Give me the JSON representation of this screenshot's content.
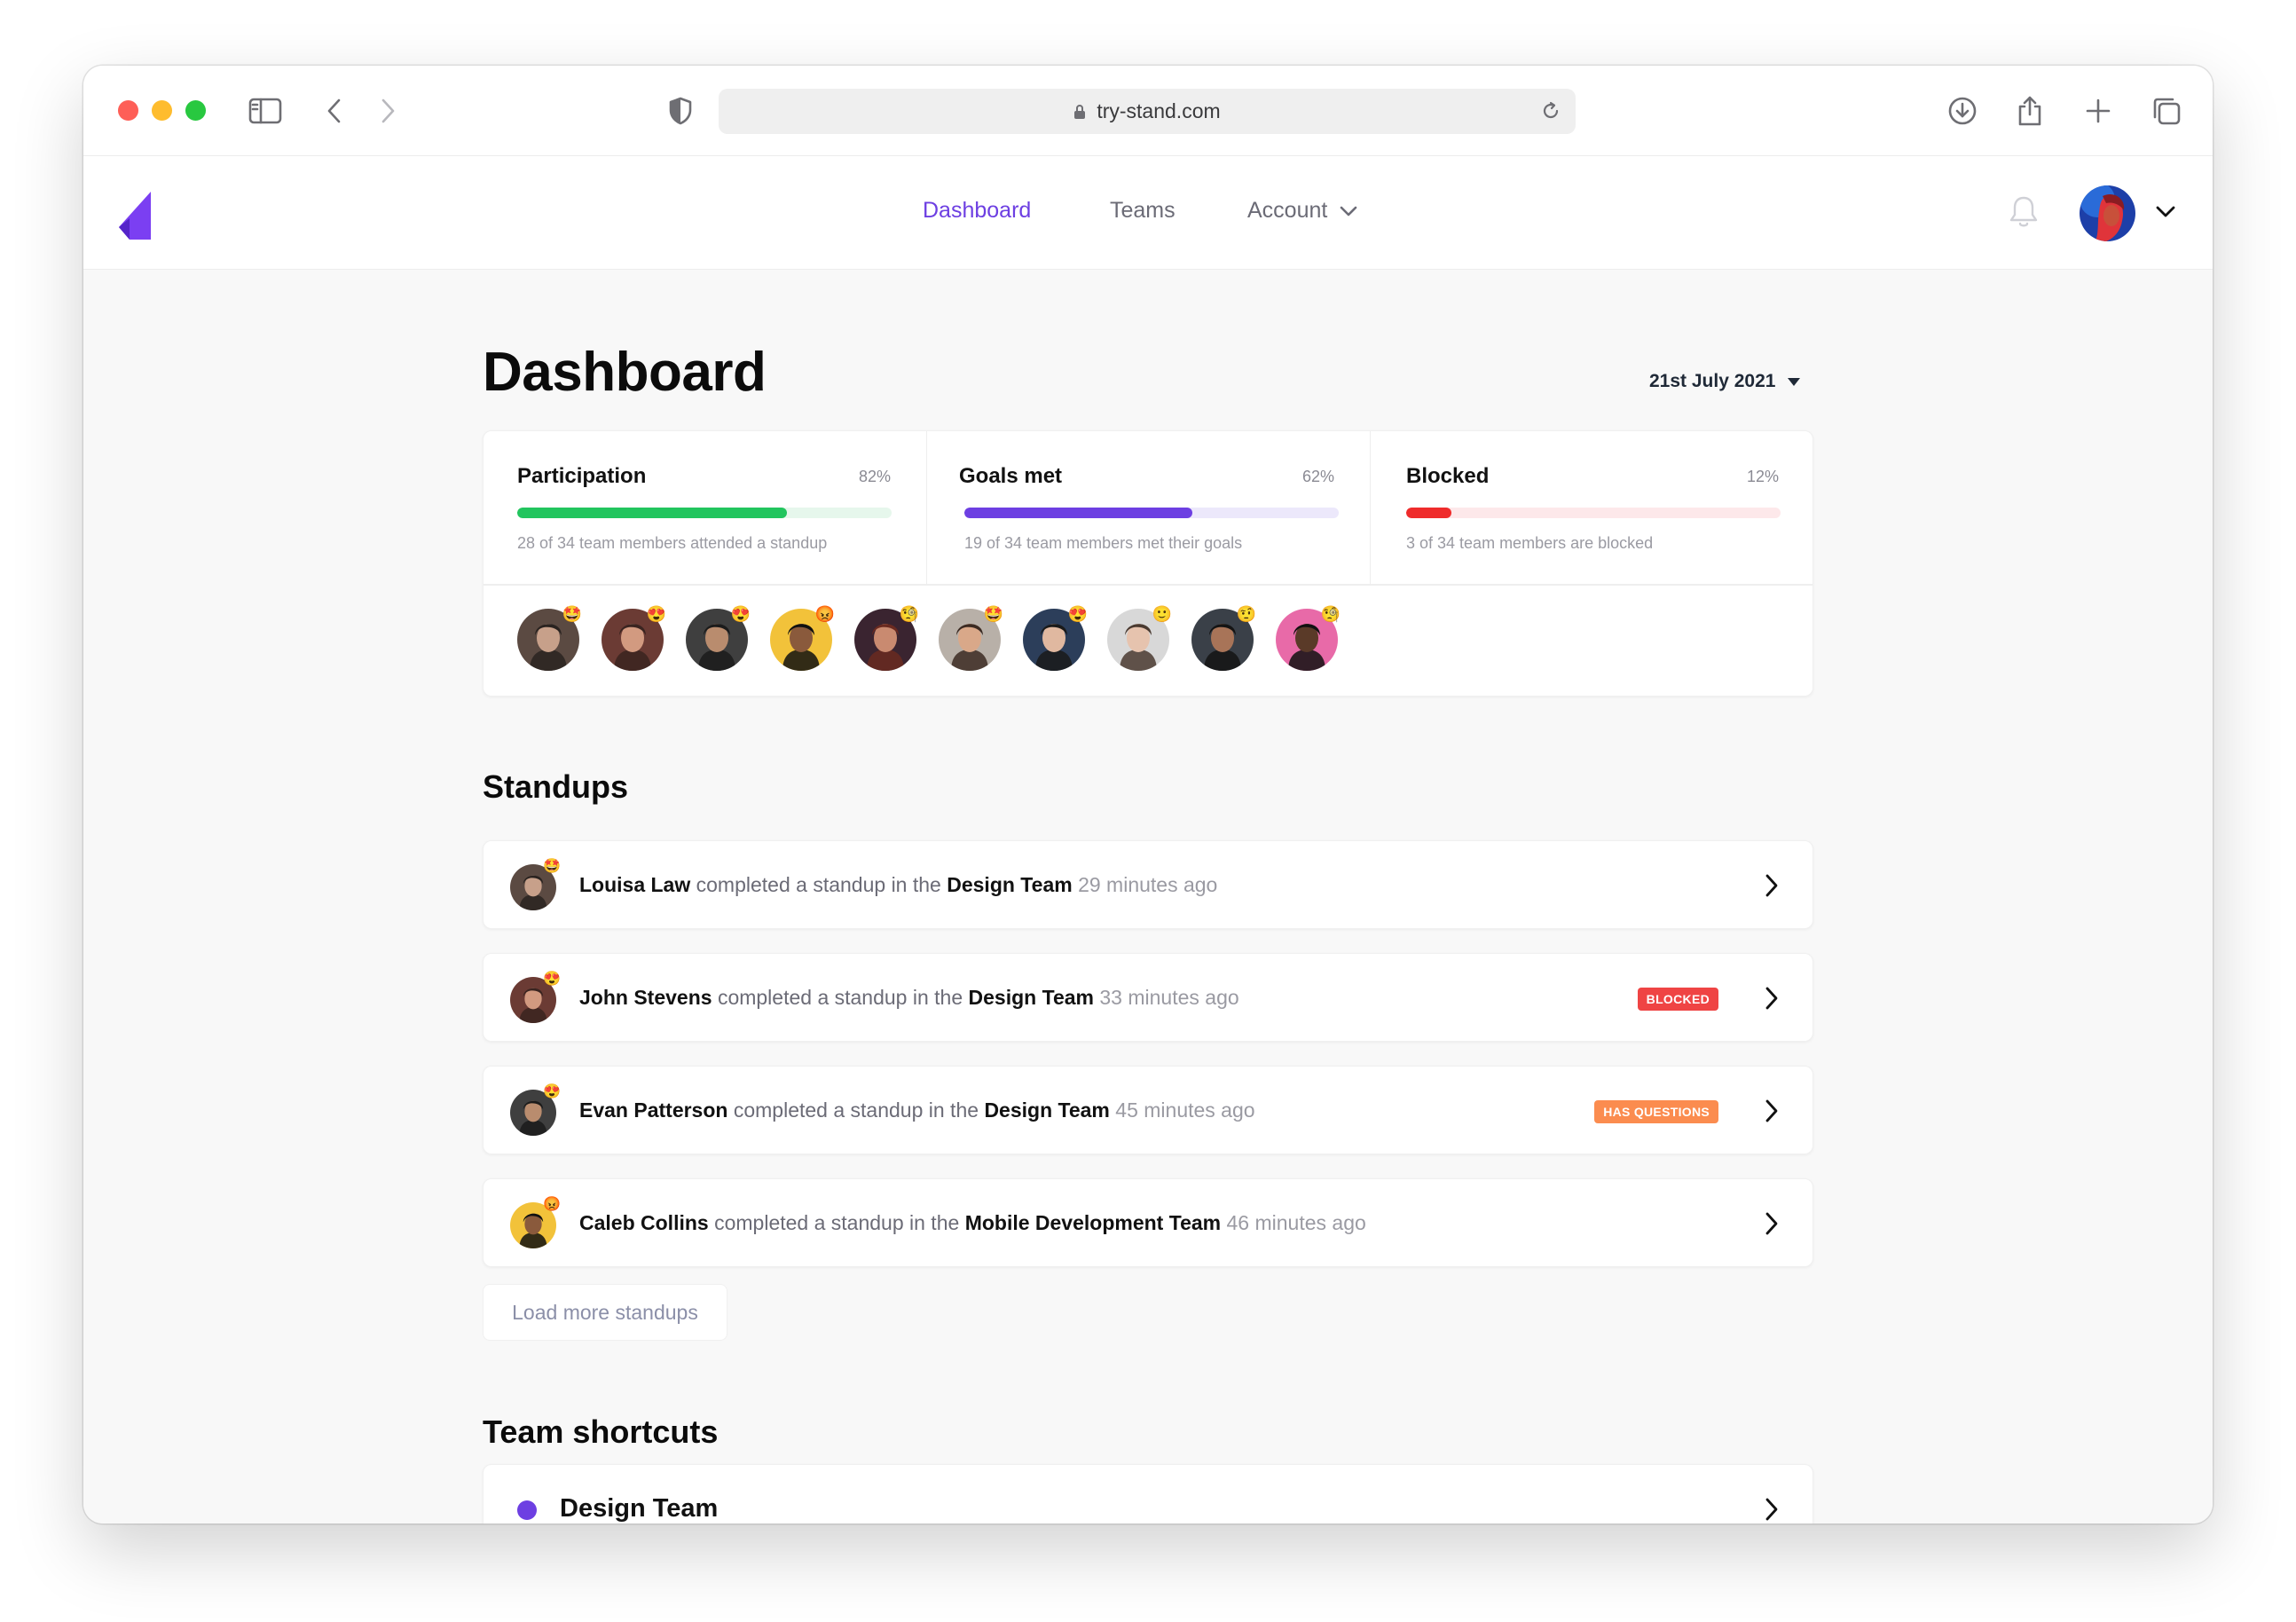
{
  "browser": {
    "url": "try-stand.com"
  },
  "nav": {
    "items": [
      {
        "label": "Dashboard",
        "active": true
      },
      {
        "label": "Teams",
        "active": false
      },
      {
        "label": "Account",
        "active": false
      }
    ]
  },
  "page": {
    "title": "Dashboard",
    "date": "21st July 2021"
  },
  "stats": [
    {
      "label": "Participation",
      "percent_text": "82%",
      "value": 0.72,
      "color": "#22c55e",
      "track": "#e6f7ec",
      "subtitle": "28 of 34 team members attended a standup"
    },
    {
      "label": "Goals met",
      "percent_text": "62%",
      "value": 0.61,
      "color": "#6d3fe2",
      "track": "#ece8fb",
      "subtitle": "19 of 34 team members met their goals"
    },
    {
      "label": "Blocked",
      "percent_text": "12%",
      "value": 0.12,
      "color": "#ef2b2b",
      "track": "#fde8ea",
      "subtitle": "3 of 34 team members are blocked"
    }
  ],
  "members": [
    {
      "emoji": "🤩",
      "bg": "#5b4a42",
      "skin": "#c7a08a",
      "hair": "#2a2320"
    },
    {
      "emoji": "😍",
      "bg": "#6b3b34",
      "skin": "#d29a80",
      "hair": "#3a2420"
    },
    {
      "emoji": "😍",
      "bg": "#3f3f3f",
      "skin": "#b98c6e",
      "hair": "#1b1b1b"
    },
    {
      "emoji": "😡",
      "bg": "#f2c23a",
      "skin": "#8a5a3c",
      "hair": "#111111"
    },
    {
      "emoji": "🧐",
      "bg": "#3a2430",
      "skin": "#c98a70",
      "hair": "#6a2a20"
    },
    {
      "emoji": "🤩",
      "bg": "#b8b0a8",
      "skin": "#d9a889",
      "hair": "#3b2a22"
    },
    {
      "emoji": "😍",
      "bg": "#2c3e5a",
      "skin": "#e0b8a0",
      "hair": "#1a1a1a"
    },
    {
      "emoji": "🙂",
      "bg": "#d8d8d8",
      "skin": "#e6c3ae",
      "hair": "#4a3a30"
    },
    {
      "emoji": "🤨",
      "bg": "#3a4048",
      "skin": "#a87458",
      "hair": "#141414"
    },
    {
      "emoji": "🧐",
      "bg": "#e86aa8",
      "skin": "#5a3a28",
      "hair": "#111111"
    }
  ],
  "standups": {
    "title": "Standups",
    "connector": "completed a standup in the",
    "items": [
      {
        "name": "Louisa Law",
        "team": "Design Team",
        "time": "29 minutes ago",
        "badge": "",
        "emoji": "🤩",
        "bg": "#5b4a42",
        "skin": "#c7a08a",
        "hair": "#2a2320"
      },
      {
        "name": "John Stevens",
        "team": "Design Team",
        "time": "33 minutes ago",
        "badge": "BLOCKED",
        "emoji": "😍",
        "bg": "#6b3b34",
        "skin": "#d29a80",
        "hair": "#3a2420"
      },
      {
        "name": "Evan Patterson",
        "team": "Design Team",
        "time": "45 minutes ago",
        "badge": "HAS QUESTIONS",
        "emoji": "😍",
        "bg": "#3f3f3f",
        "skin": "#b98c6e",
        "hair": "#1b1b1b"
      },
      {
        "name": "Caleb Collins",
        "team": "Mobile Development Team",
        "time": "46 minutes ago",
        "badge": "",
        "emoji": "😡",
        "bg": "#f2c23a",
        "skin": "#8a5a3c",
        "hair": "#111111"
      }
    ],
    "load_more": "Load more standups"
  },
  "shortcuts": {
    "title": "Team shortcuts",
    "items": [
      {
        "label": "Design Team",
        "color": "#6d3fe2"
      }
    ]
  },
  "colors": {
    "accent": "#6d3fe2",
    "badge_blocked": "#ef4444",
    "badge_questions": "#fb8c4f"
  }
}
